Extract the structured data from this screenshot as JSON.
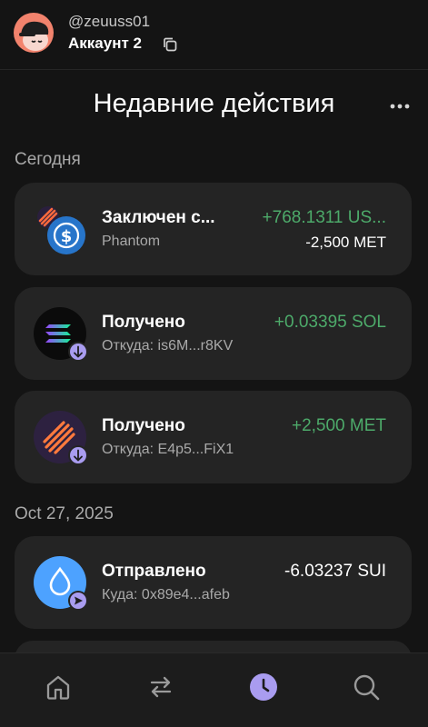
{
  "header": {
    "username": "@zeuuss01",
    "account": "Аккаунт 2"
  },
  "page": {
    "title": "Недавние действия"
  },
  "sections": [
    {
      "label": "Сегодня"
    },
    {
      "label": "Oct 27, 2025"
    }
  ],
  "activities": [
    {
      "title": "Заключен с...",
      "subtitle": "Phantom",
      "amount": "+768.1311 US...",
      "amount2": "-2,500 MET",
      "icon": "usdc-icon"
    },
    {
      "title": "Получено",
      "subtitle": "Откуда: is6M...r8KV",
      "amount": "+0.03395 SOL",
      "icon": "solana-icon"
    },
    {
      "title": "Получено",
      "subtitle": "Откуда: E4p5...FiX1",
      "amount": "+2,500 MET",
      "icon": "meteora-icon"
    },
    {
      "title": "Отправлено",
      "subtitle": "Куда: 0x89e4...afeb",
      "amount": "-6.03237 SUI",
      "icon": "sui-icon"
    }
  ],
  "colors": {
    "background": "#141414",
    "card": "#242424",
    "positive": "#4daa6a",
    "accent": "#a99cf0"
  },
  "nav": [
    "home-icon",
    "swap-icon",
    "history-icon",
    "search-icon"
  ]
}
